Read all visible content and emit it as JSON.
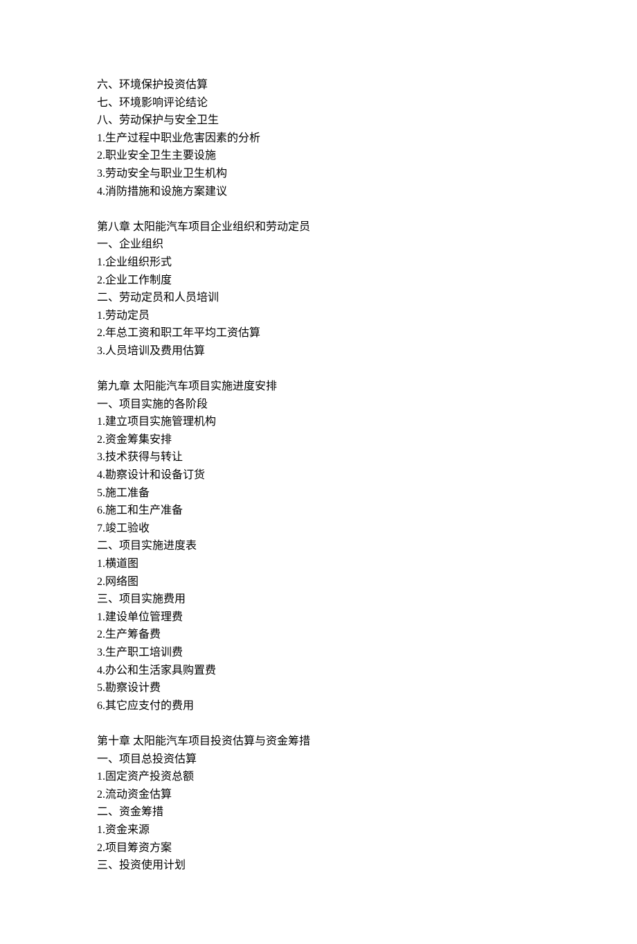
{
  "block1": {
    "l1": "六、环境保护投资估算",
    "l2": "七、环境影响评论结论",
    "l3": "八、劳动保护与安全卫生",
    "l4": "1.生产过程中职业危害因素的分析",
    "l5": "2.职业安全卫生主要设施",
    "l6": "3.劳动安全与职业卫生机构",
    "l7": "4.消防措施和设施方案建议"
  },
  "block2": {
    "l1": "第八章 太阳能汽车项目企业组织和劳动定员",
    "l2": "一、企业组织",
    "l3": "1.企业组织形式",
    "l4": "2.企业工作制度",
    "l5": "二、劳动定员和人员培训",
    "l6": "1.劳动定员",
    "l7": "2.年总工资和职工年平均工资估算",
    "l8": "3.人员培训及费用估算"
  },
  "block3": {
    "l1": "第九章 太阳能汽车项目实施进度安排",
    "l2": "一、项目实施的各阶段",
    "l3": "1.建立项目实施管理机构",
    "l4": "2.资金筹集安排",
    "l5": "3.技术获得与转让",
    "l6": "4.勘察设计和设备订货",
    "l7": "5.施工准备",
    "l8": "6.施工和生产准备",
    "l9": "7.竣工验收",
    "l10": "二、项目实施进度表",
    "l11": "1.横道图",
    "l12": "2.网络图",
    "l13": "三、项目实施费用",
    "l14": "1.建设单位管理费",
    "l15": "2.生产筹备费",
    "l16": "3.生产职工培训费",
    "l17": "4.办公和生活家具购置费",
    "l18": "5.勘察设计费",
    "l19": "6.其它应支付的费用"
  },
  "block4": {
    "l1": "第十章 太阳能汽车项目投资估算与资金筹措",
    "l2": "一、项目总投资估算",
    "l3": "1.固定资产投资总额",
    "l4": "2.流动资金估算",
    "l5": "二、资金筹措",
    "l6": "1.资金来源",
    "l7": "2.项目筹资方案",
    "l8": "三、投资使用计划"
  }
}
